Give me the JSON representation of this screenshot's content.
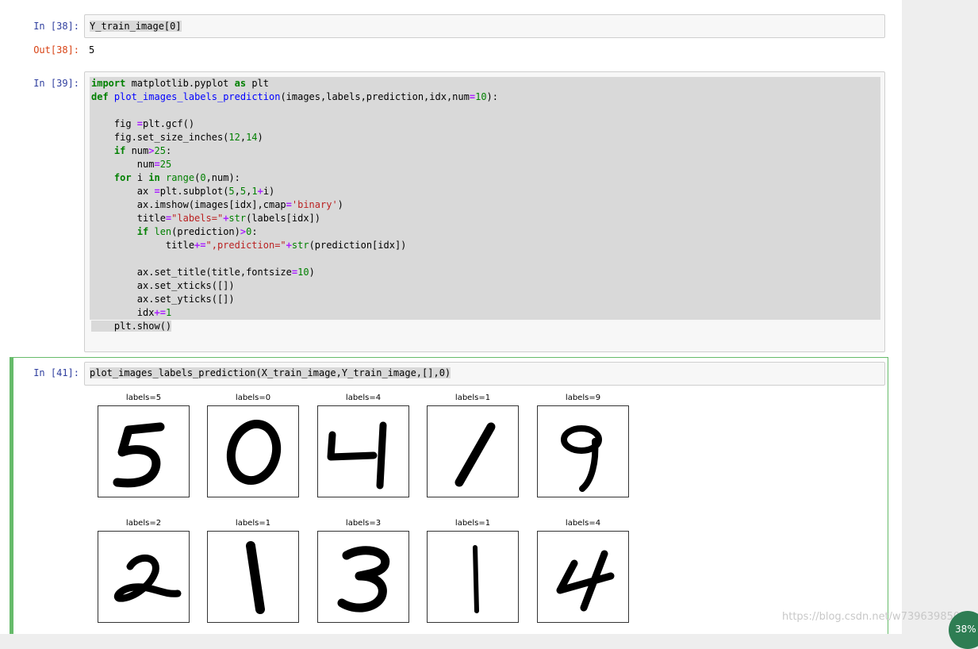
{
  "cells": {
    "c38": {
      "in_prompt": "In [38]:",
      "code": "Y_train_image[0]",
      "out_prompt": "Out[38]:",
      "output": "5"
    },
    "c39": {
      "in_prompt": "In [39]:"
    },
    "c41": {
      "in_prompt": "In [41]:",
      "code": "plot_images_labels_prediction(X_train_image,Y_train_image,[],0)"
    }
  },
  "plots": [
    {
      "title": "labels=5",
      "digit": "5"
    },
    {
      "title": "labels=0",
      "digit": "0"
    },
    {
      "title": "labels=4",
      "digit": "4"
    },
    {
      "title": "labels=1",
      "digit": "1a"
    },
    {
      "title": "labels=9",
      "digit": "9"
    },
    {
      "title": "labels=2",
      "digit": "2"
    },
    {
      "title": "labels=1",
      "digit": "1b"
    },
    {
      "title": "labels=3",
      "digit": "3"
    },
    {
      "title": "labels=1",
      "digit": "1c"
    },
    {
      "title": "labels=4",
      "digit": "4b"
    }
  ],
  "watermark": "https://blog.csdn.net/w739639850",
  "badge": "38%"
}
